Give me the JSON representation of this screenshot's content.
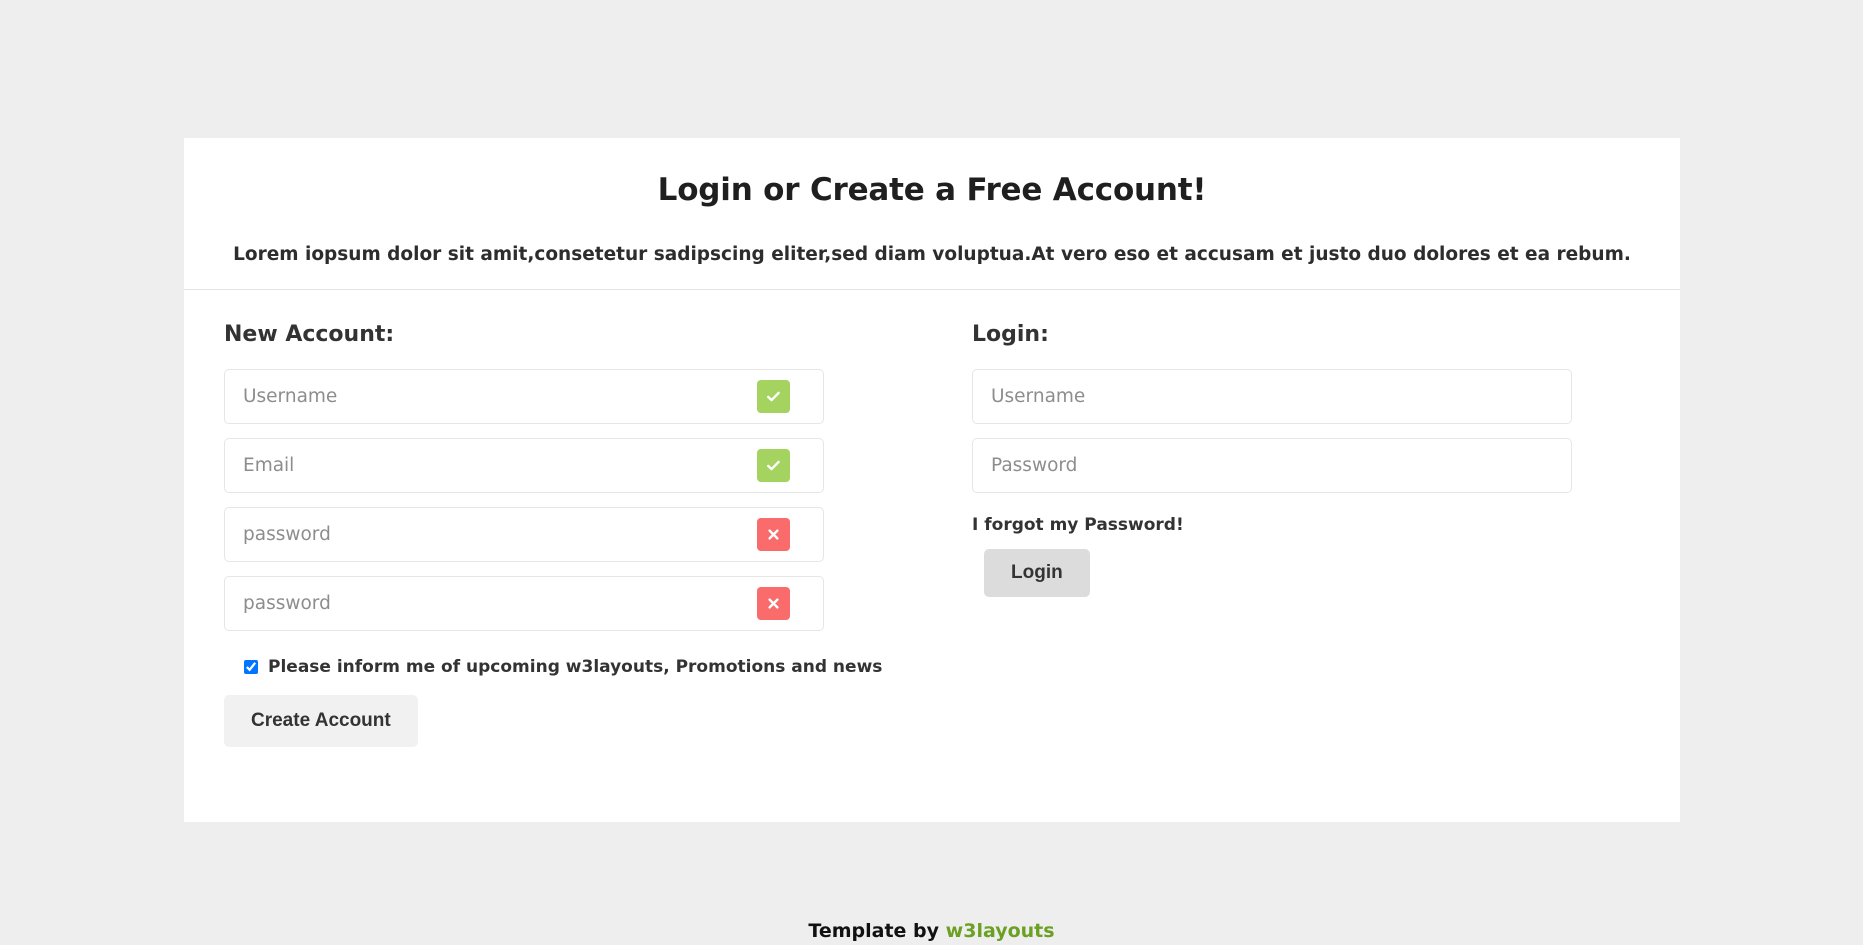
{
  "page": {
    "background_color": "#eeeeee",
    "card_background": "#ffffff"
  },
  "header": {
    "title": "Login or Create a Free Account!",
    "subtitle": "Lorem iopsum dolor sit amit,consetetur sadipscing eliter,sed diam voluptua.At vero eso et accusam et justo duo dolores et ea rebum."
  },
  "new_account": {
    "heading": "New Account:",
    "fields": [
      {
        "placeholder": "Username",
        "value": "",
        "type": "text",
        "status": "ok",
        "icon": "check-icon"
      },
      {
        "placeholder": "Email",
        "value": "",
        "type": "text",
        "status": "ok",
        "icon": "check-icon"
      },
      {
        "placeholder": "password",
        "value": "",
        "type": "password",
        "status": "error",
        "icon": "cross-icon"
      },
      {
        "placeholder": "password",
        "value": "",
        "type": "password",
        "status": "error",
        "icon": "cross-icon"
      }
    ],
    "newsletter": {
      "label": "Please inform me of upcoming w3layouts, Promotions and news",
      "checked": true
    },
    "submit_label": "Create Account"
  },
  "login": {
    "heading": "Login:",
    "fields": [
      {
        "placeholder": "Username",
        "value": "",
        "type": "text"
      },
      {
        "placeholder": "Password",
        "value": "",
        "type": "password"
      }
    ],
    "forgot_label": "I forgot my Password!",
    "submit_label": "Login"
  },
  "footer": {
    "prefix": "Template by ",
    "brand": "w3layouts"
  },
  "colors": {
    "success": "#a4d360",
    "error": "#fa6b6b",
    "brand_green": "#6ba023",
    "text": "#333333",
    "placeholder": "#8d8d8d"
  }
}
